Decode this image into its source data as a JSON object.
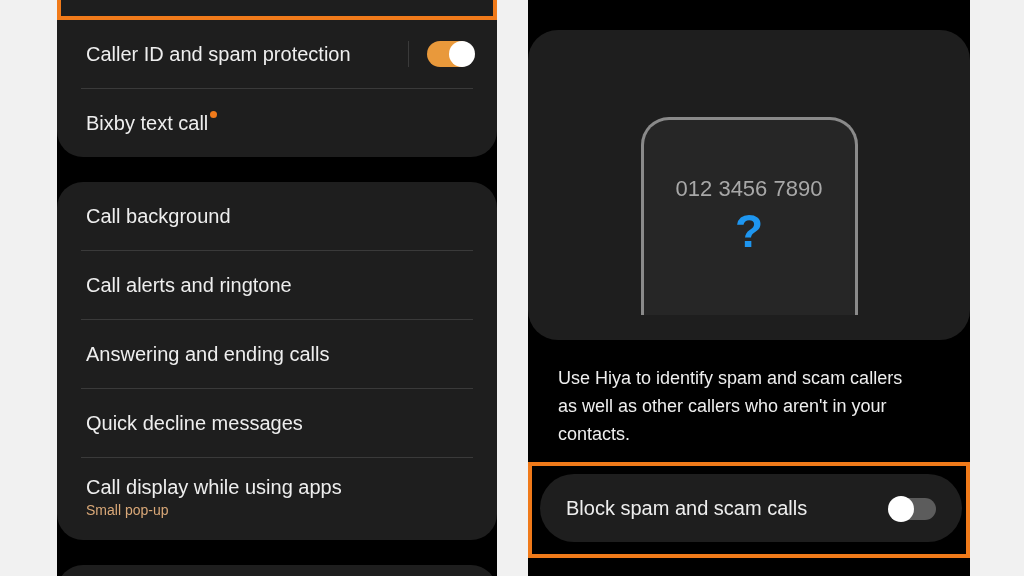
{
  "left_panel": {
    "cut_item": {
      "highlighted": true
    },
    "card_1": [
      {
        "kind": "toggle",
        "label": "Caller ID and spam protection",
        "on": true
      },
      {
        "kind": "new",
        "label": "Bixby text call",
        "new": true
      }
    ],
    "card_2": [
      {
        "kind": "plain",
        "label": "Call background"
      },
      {
        "kind": "plain",
        "label": "Call alerts and ringtone"
      },
      {
        "kind": "plain",
        "label": "Answering and ending calls"
      },
      {
        "kind": "plain",
        "label": "Quick decline messages"
      },
      {
        "kind": "subtitle",
        "label": "Call display while using apps",
        "subtitle": "Small pop-up"
      }
    ]
  },
  "right_panel": {
    "illustration": {
      "phone_number": "012 3456 7890",
      "symbol": "?"
    },
    "description": "Use Hiya to identify spam and scam callers as well as other callers who aren't in your contacts.",
    "block_row": {
      "label": "Block spam and scam calls",
      "on": false,
      "highlighted": true
    }
  }
}
